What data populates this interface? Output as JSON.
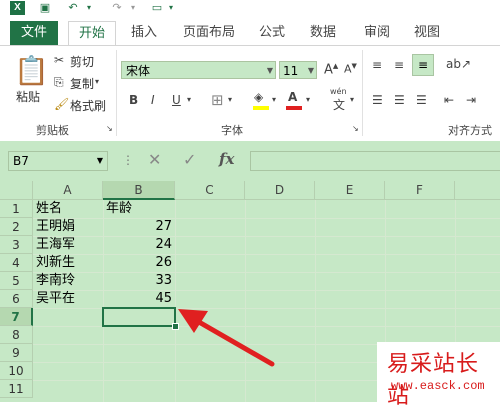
{
  "app": {
    "logo_letter": "X"
  },
  "tabs": [
    "文件",
    "开始",
    "插入",
    "页面布局",
    "公式",
    "数据",
    "审阅",
    "视图"
  ],
  "ribbon": {
    "clipboard": {
      "paste": "粘贴",
      "cut": "剪切",
      "copy": "复制",
      "format_painter": "格式刷",
      "group": "剪贴板"
    },
    "font": {
      "name": "宋体",
      "size": "11",
      "bold": "B",
      "italic": "I",
      "underline": "U",
      "phonetic": "wén",
      "group": "字体"
    },
    "alignment": {
      "group": "对齐方式"
    }
  },
  "formula_bar": {
    "name_box": "B7",
    "fx": "fx",
    "formula": ""
  },
  "sheet": {
    "columns": [
      "A",
      "B",
      "C",
      "D",
      "E",
      "F"
    ],
    "rows": [
      "1",
      "2",
      "3",
      "4",
      "5",
      "6",
      "7",
      "8",
      "9",
      "10",
      "11"
    ],
    "cells": [
      [
        "姓名",
        "年龄"
      ],
      [
        "王明娟",
        "27"
      ],
      [
        "王海军",
        "24"
      ],
      [
        "刘新生",
        "26"
      ],
      [
        "李南玲",
        "33"
      ],
      [
        "吴平在",
        "45"
      ]
    ],
    "selected_cell": "B7"
  },
  "watermark": {
    "title": "易采站长站",
    "url": "www.easck.com"
  },
  "colors": {
    "accent": "#217346",
    "sheet_bg": "#c6e8c6",
    "arrow": "#e02020"
  }
}
